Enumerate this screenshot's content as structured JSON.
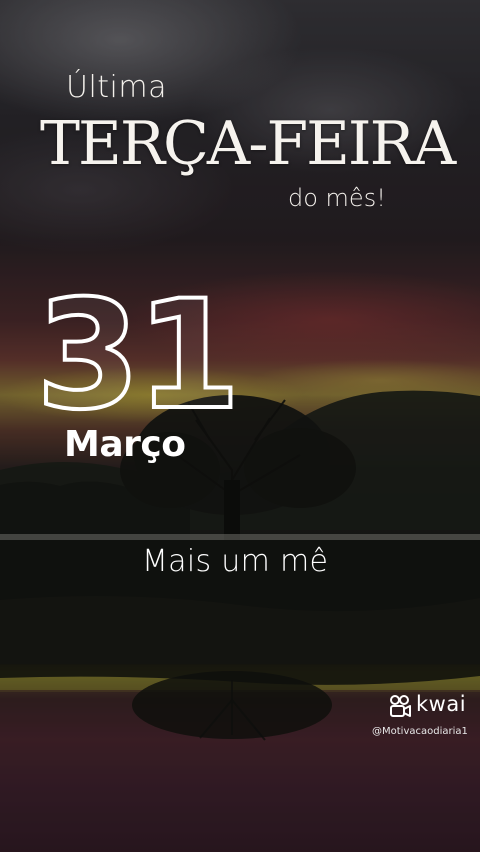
{
  "title": {
    "line1": "Última",
    "line2": "TERÇA-FEIRA",
    "line3": "do mês!"
  },
  "date": {
    "day": "31",
    "month": "Março"
  },
  "caption": "Mais um mê",
  "watermark": {
    "brand": "kwai",
    "handle": "@Motivacaodiaria1",
    "icon": "kwai-camera-logo"
  },
  "colors": {
    "text": "#ffffff",
    "sky_red": "#6b3b34",
    "horizon_yellow": "#8e7a3a"
  }
}
